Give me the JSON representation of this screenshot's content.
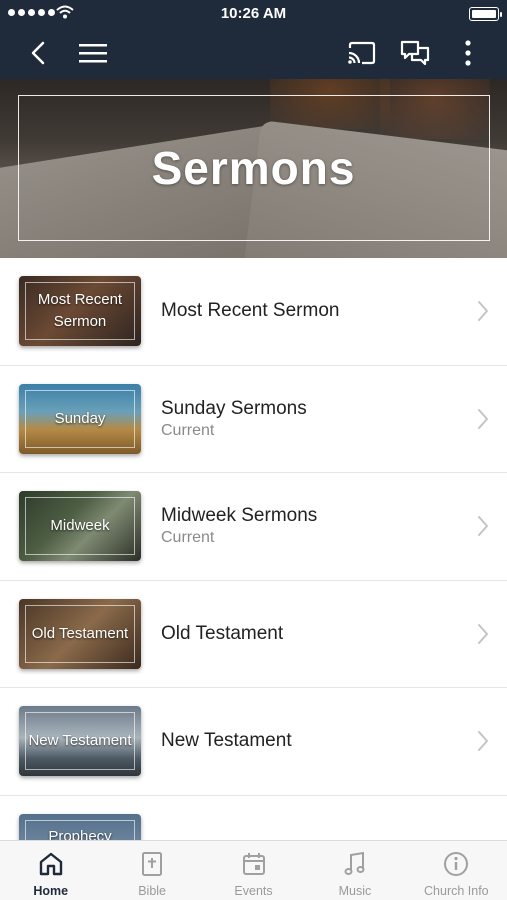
{
  "status_bar": {
    "time": "10:26 AM",
    "signal_icon": "signal-dots-icon",
    "wifi_icon": "wifi-icon",
    "battery_icon": "battery-icon",
    "battery_level": 1.0
  },
  "nav_bar": {
    "back_icon": "chevron-left-icon",
    "menu_icon": "hamburger-menu-icon",
    "cast_icon": "cast-icon",
    "chat_icon": "chat-bubbles-icon",
    "more_icon": "more-vertical-icon"
  },
  "hero": {
    "title": "Sermons"
  },
  "list": {
    "items": [
      {
        "thumb_label": "Most Recent Sermon",
        "title": "Most Recent Sermon",
        "subtitle": ""
      },
      {
        "thumb_label": "Sunday",
        "title": "Sunday Sermons",
        "subtitle": "Current"
      },
      {
        "thumb_label": "Midweek",
        "title": "Midweek Sermons",
        "subtitle": "Current"
      },
      {
        "thumb_label": "Old Testament",
        "title": "Old Testament",
        "subtitle": ""
      },
      {
        "thumb_label": "New Testament",
        "title": "New Testament",
        "subtitle": ""
      },
      {
        "thumb_label": "Prophecy",
        "title": "",
        "subtitle": ""
      }
    ]
  },
  "tab_bar": {
    "tabs": [
      {
        "label": "Home",
        "icon": "home-icon",
        "active": true
      },
      {
        "label": "Bible",
        "icon": "bible-icon",
        "active": false
      },
      {
        "label": "Events",
        "icon": "calendar-icon",
        "active": false
      },
      {
        "label": "Music",
        "icon": "music-note-icon",
        "active": false
      },
      {
        "label": "Church Info",
        "icon": "info-icon",
        "active": false
      }
    ]
  },
  "colors": {
    "nav_background": "#1f2b3a",
    "tab_active": "#1f2b3a",
    "tab_inactive": "#9a9a9a",
    "row_title": "#222222",
    "row_subtitle": "#8a8a8a"
  }
}
